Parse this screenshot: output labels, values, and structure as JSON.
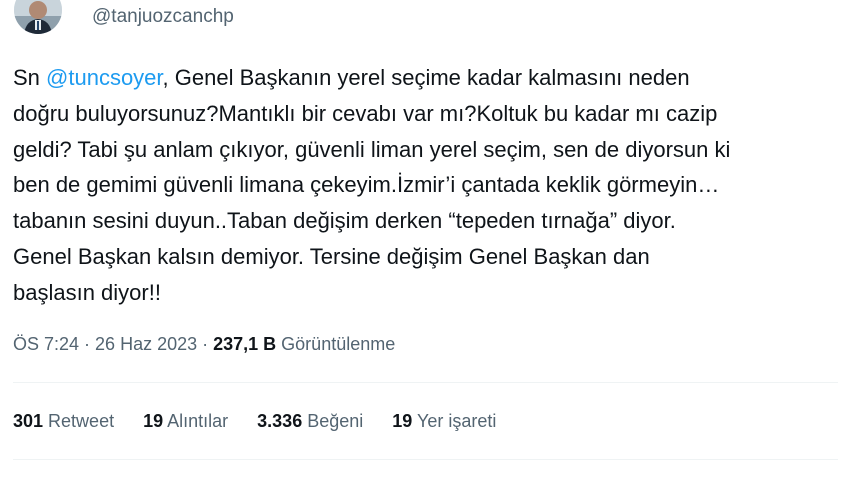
{
  "author": {
    "handle": "@tanjuozcanchp"
  },
  "tweet": {
    "prefix": "Sn ",
    "mention": "@tuncsoyer",
    "text": ", Genel Başkanın yerel seçime kadar kalmasını neden\ndoğru buluyorsunuz?Mantıklı bir cevabı var mı?Koltuk bu kadar mı cazip\ngeldi? Tabi şu anlam çıkıyor, güvenli liman yerel seçim, sen de diyorsun ki\nben de gemimi güvenli limana çekeyim.İzmir’i çantada keklik görmeyin…\ntabanın sesini duyun..Taban değişim derken “tepeden tırnağa” diyor.\nGenel Başkan kalsın demiyor. Tersine değişim Genel Başkan dan\nbaşlasın diyor!!"
  },
  "meta": {
    "time": "ÖS 7:24",
    "separator": " · ",
    "date": "26 Haz 2023",
    "separator2": " · ",
    "views_count": "237,1 B",
    "views_label": " Görüntülenme"
  },
  "stats": [
    {
      "count": "301",
      "label": " Retweet"
    },
    {
      "count": "19",
      "label": " Alıntılar"
    },
    {
      "count": "3.336",
      "label": " Beğeni"
    },
    {
      "count": "19",
      "label": " Yer işareti"
    }
  ],
  "icons": {
    "avatar": "profile-photo"
  }
}
